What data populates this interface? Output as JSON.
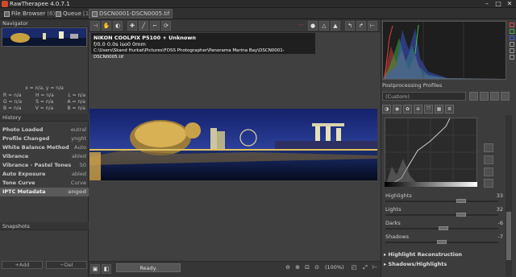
{
  "window": {
    "title": "RawTherapee 4.0.7.1",
    "minimize": "–",
    "maximize": "□",
    "close": "✕"
  },
  "tabs": [
    {
      "label": "File Browser",
      "count": "(6)"
    },
    {
      "label": "Queue",
      "count": "[1]"
    },
    {
      "label": "DSCN0001-DSCN0005.tif"
    }
  ],
  "navigator": {
    "title": "Navigator",
    "coords": "x = n/a, y = n/a",
    "values": [
      [
        "R = n/a",
        "H = n/a",
        "L = n/a"
      ],
      [
        "G = n/a",
        "S = n/a",
        "A = n/a"
      ],
      [
        "B = n/a",
        "V = n/a",
        "B = n/a"
      ]
    ]
  },
  "history": {
    "title": "History",
    "items": [
      {
        "action": "Photo Loaded",
        "value": "eutral"
      },
      {
        "action": "Profile Changed",
        "value": "ynght"
      },
      {
        "action": "White Balance Method",
        "value": "Auto"
      },
      {
        "action": "Vibrance",
        "value": "abled"
      },
      {
        "action": "Vibrance - Pastel Tones",
        "value": "50"
      },
      {
        "action": "Auto Exposure",
        "value": "abled"
      },
      {
        "action": "Tone Curve",
        "value": "Curve"
      },
      {
        "action": "IPTC Metadata",
        "value": "anged"
      }
    ]
  },
  "snapshots": {
    "title": "Snapshots",
    "add": "+Add",
    "del": "−Del"
  },
  "exif": {
    "camera": "NIKON COOLPIX P5100 + Unknown",
    "settings": "f/0.0  0.0s  iso0  0mm",
    "path": "C:\\Users\\Skand Hurkat\\Pictures\\FOSS Photographer\\Panorama Marina Bay\\DSCN0001-DSCN0005.tif"
  },
  "status": {
    "ready": "Ready.",
    "zoom": "(100%)"
  },
  "postprocessing": {
    "title": "Postprocessing Profiles",
    "profile": "(Custom)"
  },
  "sliders": [
    {
      "label": "Highlights",
      "value": "33"
    },
    {
      "label": "Lights",
      "value": "32"
    },
    {
      "label": "Darks",
      "value": "-6"
    },
    {
      "label": "Shadows",
      "value": "-7"
    }
  ],
  "sections": {
    "highlight": "Highlight Reconstruction",
    "shadows": "Shadows/Highlights"
  },
  "colors": {
    "accent": "#e04848",
    "histRed": "#e23a3a",
    "histGreen": "#3fb23f",
    "histBlue": "#4060e6"
  }
}
